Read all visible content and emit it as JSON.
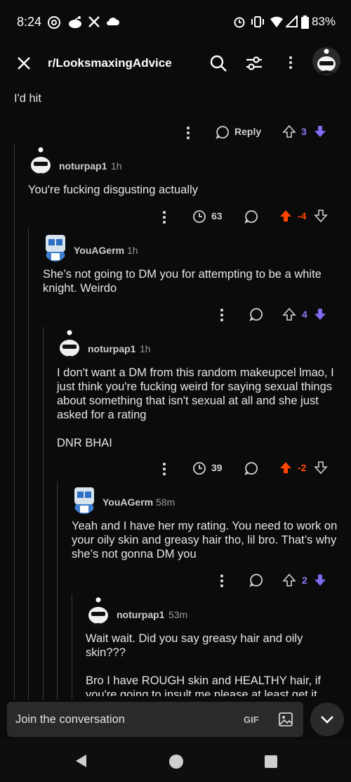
{
  "status": {
    "time": "8:24",
    "battery": "83%"
  },
  "header": {
    "subreddit": "r/LooksmaxingAdvice"
  },
  "parent_tail": {
    "text": "I'd hit",
    "votes": "3",
    "reply_label": "Reply"
  },
  "comments": [
    {
      "user": "noturpap1",
      "age": "1h",
      "text": "You're fucking disgusting actually",
      "awards": "63",
      "votes": "-4",
      "vote_state": "up"
    },
    {
      "user": "YouAGerm",
      "age": "1h",
      "text": "She’s not going to DM you for attempting to be a white knight. Weirdo",
      "votes": "4",
      "vote_state": "down"
    },
    {
      "user": "noturpap1",
      "age": "1h",
      "text": "I don't want a DM from this random makeupcel lmao, I just think you're fucking weird for saying sexual things about something that isn't sexual at all and she just asked for a rating\n\nDNR BHAI",
      "awards": "39",
      "votes": "-2",
      "vote_state": "up"
    },
    {
      "user": "YouAGerm",
      "age": "58m",
      "text": "Yeah and I have her my rating. You need to work on your oily skin and greasy hair tho, lil bro. That’s why she’s not gonna DM you",
      "votes": "2",
      "vote_state": "down"
    },
    {
      "user": "noturpap1",
      "age": "53m",
      "text": "Wait wait. Did you say greasy hair and oily skin???\n\nBro I have ROUGH skin and HEALTHY hair, if you're going to insult me please at least get it"
    }
  ],
  "composer": {
    "placeholder": "Join the conversation",
    "gif_label": "GIF"
  },
  "colors": {
    "background": "#0b0b0b",
    "upvote_active": "#ff4500",
    "downvote_active": "#7c6cf0",
    "text": "#e6e6e6"
  },
  "icons": [
    "close-icon",
    "search-icon",
    "filter-icon",
    "more-icon",
    "avatar",
    "comment-icon",
    "award-icon",
    "upvote-icon",
    "downvote-icon",
    "image-icon",
    "chevron-down-icon",
    "back-icon",
    "home-icon",
    "recents-icon"
  ]
}
